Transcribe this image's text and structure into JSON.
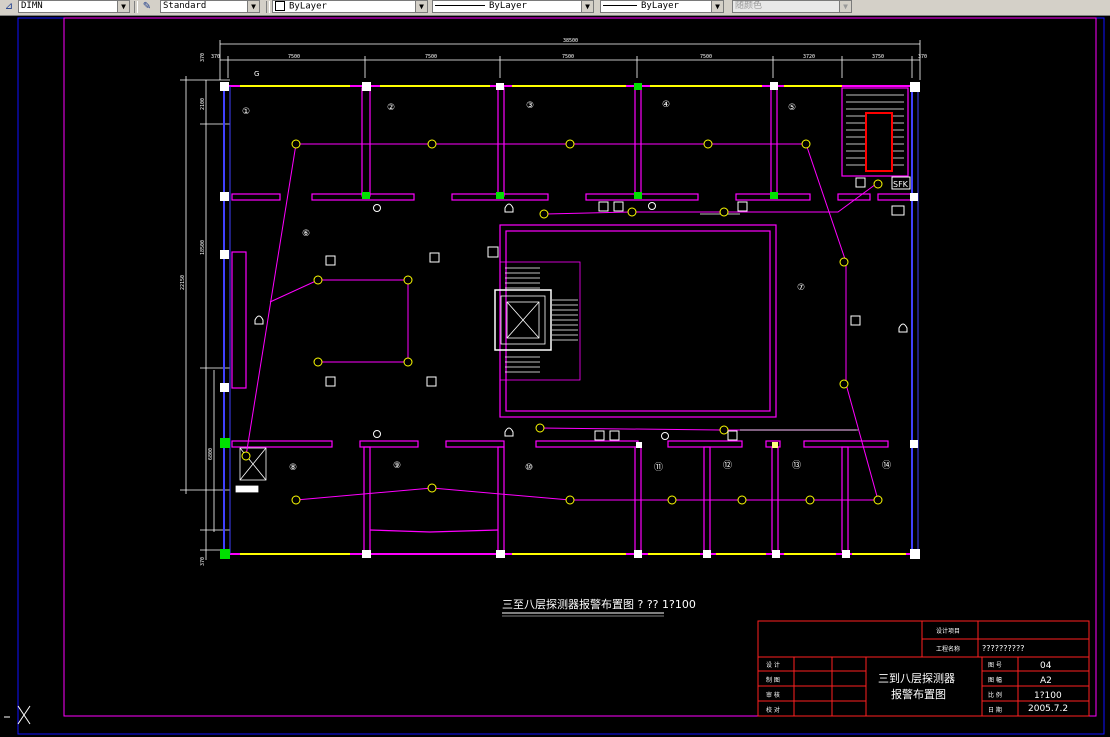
{
  "toolbar": {
    "dimstyle": "DIMN",
    "textstyle": "Standard",
    "layer": "ByLayer",
    "linetype": "ByLayer",
    "lineweight": "ByLayer",
    "color": "随颜色"
  },
  "plan": {
    "caption": "三至八层探测器报警布置图  ? ?? 1?100",
    "overall_dim": "38500",
    "top_dims": [
      "370",
      "7500",
      "7500",
      "7500",
      "7500",
      "3720",
      "3750",
      "370"
    ],
    "left_dims": [
      "370",
      "2100",
      "18500",
      "22150",
      "6800",
      "370"
    ],
    "rooms": [
      "①",
      "②",
      "③",
      "④",
      "⑤",
      "⑥",
      "⑦",
      "⑧",
      "⑨",
      "⑩",
      "⑪",
      "⑫",
      "⑬",
      "⑭"
    ],
    "sfk_label": "SFK",
    "g_label": "G"
  },
  "title_block": {
    "design_project_label": "设计项目",
    "project_name_label": "工程名称",
    "project_name_value": "??????????",
    "design_label": "设 计",
    "draft_label": "制 图",
    "review_label": "审 核",
    "check_label": "校 对",
    "title_line1": "三到八层探测器",
    "title_line2": "报警布置图",
    "sheet_no_label": "图 号",
    "sheet_no": "04",
    "size_label": "图 幅",
    "size": "A2",
    "scale_label": "比 例",
    "scale": "1?100",
    "date_label": "日 期",
    "date": "2005.7.2"
  },
  "colors": {
    "wall": "#ff00ff",
    "window": "#ffff00",
    "column": "#ffffff",
    "detector": "#ffff00",
    "frame": "#ff00ff",
    "border": "#0000ff",
    "titleblock": "#ff0000",
    "ucs": "#ffffff"
  }
}
